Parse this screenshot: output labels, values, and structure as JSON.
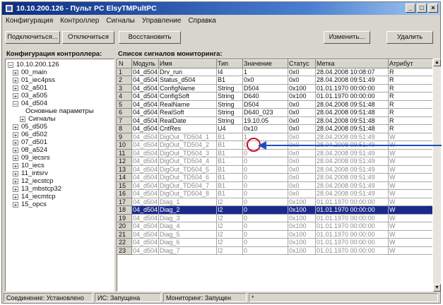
{
  "window": {
    "title": "10.10.200.126 - Пульт PC ElsyTMPultPC"
  },
  "menu": [
    "Конфигурация",
    "Контроллер",
    "Сигналы",
    "Управление",
    "Справка"
  ],
  "toolbar": {
    "connect": "Подключиться...",
    "disconnect": "Отключиться",
    "restore": "Восстановить",
    "edit": "Изменить...",
    "delete": "Удалить"
  },
  "tree": {
    "header": "Конфигурация контроллера:",
    "root": "10.10.200.126",
    "items": [
      "00_main",
      "01_iec4pss",
      "02_a501",
      "03_a505",
      "04_d504",
      "Основные параметры",
      "Сигналы",
      "05_d505",
      "06_d502",
      "07_d501",
      "08_a524",
      "09_iecsrs",
      "10_iecs",
      "11_intsrv",
      "12_iecstcp",
      "13_mbstcp32",
      "14_iecmtcp",
      "15_opcs"
    ]
  },
  "grid": {
    "header": "Список сигналов мониторинга:",
    "columns": [
      "N",
      "Модуль",
      "Имя",
      "Тип",
      "Значение",
      "Статус",
      "Метка",
      "Атрибут"
    ],
    "rows": [
      {
        "n": "1",
        "module": "04_d504",
        "name": "Drv_run",
        "type": "I4",
        "value": "1",
        "status": "0x0",
        "time": "28.04.2008 10:08:07",
        "attr": "R",
        "style": "normal"
      },
      {
        "n": "2",
        "module": "04_d504",
        "name": "Status_d504",
        "type": "B1",
        "value": "0x0",
        "status": "0x0",
        "time": "28.04.2008 09:51:49",
        "attr": "R",
        "style": "normal"
      },
      {
        "n": "3",
        "module": "04_d504",
        "name": "ConfigName",
        "type": "String",
        "value": "D504",
        "status": "0x100",
        "time": "01.01.1970 00:00:00",
        "attr": "R",
        "style": "normal"
      },
      {
        "n": "4",
        "module": "04_d504",
        "name": "ConfigSoft",
        "type": "String",
        "value": "D640",
        "status": "0x100",
        "time": "01.01.1970 00:00:00",
        "attr": "R",
        "style": "normal"
      },
      {
        "n": "5",
        "module": "04_d504",
        "name": "RealName",
        "type": "String",
        "value": "D504",
        "status": "0x0",
        "time": "28.04.2008 09:51:48",
        "attr": "R",
        "style": "normal"
      },
      {
        "n": "6",
        "module": "04_d504",
        "name": "RealSoft",
        "type": "String",
        "value": "D640_023",
        "status": "0x0",
        "time": "28.04.2008 09:51:48",
        "attr": "R",
        "style": "normal"
      },
      {
        "n": "7",
        "module": "04_d504",
        "name": "RealDate",
        "type": "String",
        "value": "19.10.05",
        "status": "0x0",
        "time": "28.04.2008 09:51:48",
        "attr": "R",
        "style": "normal"
      },
      {
        "n": "8",
        "module": "04_d504",
        "name": "CntRes",
        "type": "U4",
        "value": "0x10",
        "status": "0x0",
        "time": "28.04.2008 09:51:48",
        "attr": "R",
        "style": "normal"
      },
      {
        "n": "9",
        "module": "04_d504",
        "name": "DigOut_TD504_1",
        "type": "B1",
        "value": "1",
        "status": "0x0",
        "time": "28.04.2008 09:51:49",
        "attr": "W",
        "style": "gray"
      },
      {
        "n": "10",
        "module": "04_d504",
        "name": "DigOut_TD504_2",
        "type": "B1",
        "value": "0",
        "status": "0x0",
        "time": "28.04.2008 09:51:49",
        "attr": "W",
        "style": "gray"
      },
      {
        "n": "11",
        "module": "04_d504",
        "name": "DigOut_TD504_3",
        "type": "B1",
        "value": "0",
        "status": "0x0",
        "time": "28.04.2008 09:51:49",
        "attr": "W",
        "style": "gray"
      },
      {
        "n": "12",
        "module": "04_d504",
        "name": "DigOut_TD504_4",
        "type": "B1",
        "value": "0",
        "status": "0x0",
        "time": "28.04.2008 09:51:49",
        "attr": "W",
        "style": "gray"
      },
      {
        "n": "13",
        "module": "04_d504",
        "name": "DigOut_TD504_5",
        "type": "B1",
        "value": "0",
        "status": "0x0",
        "time": "28.04.2008 09:51:49",
        "attr": "W",
        "style": "gray"
      },
      {
        "n": "14",
        "module": "04_d504",
        "name": "DigOut_TD504_6",
        "type": "B1",
        "value": "0",
        "status": "0x0",
        "time": "28.04.2008 09:51:49",
        "attr": "W",
        "style": "gray"
      },
      {
        "n": "15",
        "module": "04_d504",
        "name": "DigOut_TD504_7",
        "type": "B1",
        "value": "0",
        "status": "0x0",
        "time": "28.04.2008 09:51:49",
        "attr": "W",
        "style": "gray"
      },
      {
        "n": "16",
        "module": "04_d504",
        "name": "DigOut_TD504_8",
        "type": "B1",
        "value": "0",
        "status": "0x0",
        "time": "28.04.2008 09:51:49",
        "attr": "W",
        "style": "gray"
      },
      {
        "n": "17",
        "module": "04_d504",
        "name": "Diag_1",
        "type": "I2",
        "value": "0",
        "status": "0x100",
        "time": "01.01.1970 00:00:00",
        "attr": "W",
        "style": "gray"
      },
      {
        "n": "18",
        "module": "04_d504",
        "name": "Diag_2",
        "type": "I2",
        "value": "0",
        "status": "0x100",
        "time": "01.01.1970 00:00:00",
        "attr": "W",
        "style": "selected"
      },
      {
        "n": "19",
        "module": "04_d504",
        "name": "Diag_3",
        "type": "I2",
        "value": "0",
        "status": "0x100",
        "time": "01.01.1970 00:00:00",
        "attr": "W",
        "style": "gray"
      },
      {
        "n": "20",
        "module": "04_d504",
        "name": "Diag_4",
        "type": "I2",
        "value": "0",
        "status": "0x100",
        "time": "01.01.1970 00:00:00",
        "attr": "W",
        "style": "gray"
      },
      {
        "n": "21",
        "module": "04_d504",
        "name": "Diag_5",
        "type": "I2",
        "value": "0",
        "status": "0x100",
        "time": "01.01.1970 00:00:00",
        "attr": "W",
        "style": "gray"
      },
      {
        "n": "22",
        "module": "04_d504",
        "name": "Diag_6",
        "type": "I2",
        "value": "0",
        "status": "0x100",
        "time": "01.01.1970 00:00:00",
        "attr": "W",
        "style": "gray"
      },
      {
        "n": "23",
        "module": "04_d504",
        "name": "Diag_7",
        "type": "I2",
        "value": "0",
        "status": "0x100",
        "time": "01.01.1970 00:00:00",
        "attr": "W",
        "style": "gray"
      }
    ]
  },
  "statusbar": {
    "connection": "Соединение: Установлено",
    "ic": "ИС: Запущена",
    "monitoring": "Мониторинг: Запущен",
    "extra": "*"
  },
  "colors": {
    "title_start": "#0c2d82",
    "selection": "#1a2a8a",
    "annotation_circle": "#c8102e",
    "annotation_arrow": "#1e4fbf"
  }
}
